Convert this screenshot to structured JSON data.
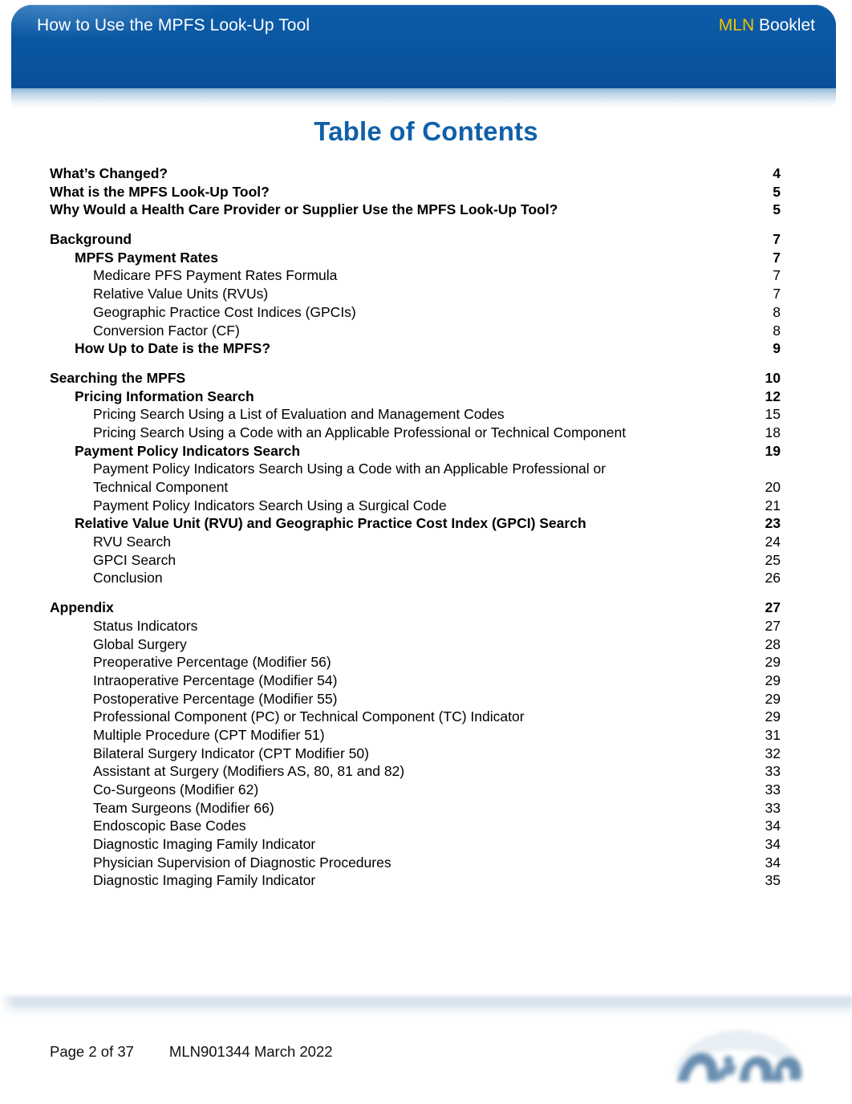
{
  "header": {
    "title": "How to Use the MPFS Look-Up Tool",
    "brand_mln": "MLN",
    "brand_rest": " Booklet",
    "bar_color": "#0a58a2",
    "brand_accent": "#f2c300"
  },
  "page_title": "Table of Contents",
  "title_color": "#1060a8",
  "toc": {
    "groups": [
      {
        "rows": [
          {
            "label": "What’s Changed?",
            "page": "4",
            "level": 0,
            "bold": true
          },
          {
            "label": "What is the MPFS Look-Up Tool?",
            "page": "5",
            "level": 0,
            "bold": true
          },
          {
            "label": "Why Would a Health Care Provider or Supplier Use the MPFS Look-Up Tool?",
            "page": "5",
            "level": 0,
            "bold": true
          }
        ]
      },
      {
        "rows": [
          {
            "label": "Background",
            "page": "7",
            "level": 0,
            "bold": true
          },
          {
            "label": "MPFS Payment Rates",
            "page": "7",
            "level": 1,
            "bold": true
          },
          {
            "label": "Medicare PFS Payment Rates Formula",
            "page": "7",
            "level": 2,
            "bold": false
          },
          {
            "label": "Relative Value Units (RVUs)",
            "page": "7",
            "level": 2,
            "bold": false
          },
          {
            "label": "Geographic Practice Cost Indices (GPCIs)",
            "page": "8",
            "level": 2,
            "bold": false
          },
          {
            "label": "Conversion Factor (CF)",
            "page": "8",
            "level": 2,
            "bold": false
          },
          {
            "label": "How Up to Date is the MPFS?",
            "page": "9",
            "level": 1,
            "bold": true
          }
        ]
      },
      {
        "rows": [
          {
            "label": "Searching the MPFS",
            "page": "10",
            "level": 0,
            "bold": true
          },
          {
            "label": "Pricing Information Search",
            "page": "12",
            "level": 1,
            "bold": true
          },
          {
            "label": "Pricing Search Using a List of Evaluation and Management Codes",
            "page": "15",
            "level": 2,
            "bold": false
          },
          {
            "label": "Pricing Search Using a Code with an Applicable Professional or Technical Component",
            "page": "18",
            "level": 2,
            "bold": false
          },
          {
            "label": "Payment Policy Indicators Search",
            "page": "19",
            "level": 1,
            "bold": true
          },
          {
            "label": "Payment Policy Indicators Search Using a Code with an Applicable Professional or",
            "page": "",
            "level": 2,
            "bold": false
          },
          {
            "label": "Technical Component",
            "page": "20",
            "level": 2,
            "bold": false,
            "continuation": true
          },
          {
            "label": "Payment Policy Indicators Search Using a Surgical Code",
            "page": "21",
            "level": 2,
            "bold": false
          },
          {
            "label": "Relative Value Unit (RVU) and Geographic Practice Cost Index (GPCI) Search",
            "page": "23",
            "level": 1,
            "bold": true
          },
          {
            "label": "RVU Search",
            "page": "24",
            "level": 2,
            "bold": false
          },
          {
            "label": "GPCI Search",
            "page": "25",
            "level": 2,
            "bold": false
          },
          {
            "label": "Conclusion",
            "page": "26",
            "level": 2,
            "bold": false
          }
        ]
      },
      {
        "rows": [
          {
            "label": "Appendix",
            "page": "27",
            "level": 0,
            "bold": true
          },
          {
            "label": "Status Indicators",
            "page": "27",
            "level": 2,
            "bold": false
          },
          {
            "label": "Global Surgery",
            "page": "28",
            "level": 2,
            "bold": false
          },
          {
            "label": "Preoperative Percentage (Modifier 56)",
            "page": "29",
            "level": 2,
            "bold": false
          },
          {
            "label": "Intraoperative Percentage (Modifier 54)",
            "page": "29",
            "level": 2,
            "bold": false
          },
          {
            "label": "Postoperative Percentage (Modifier 55)",
            "page": "29",
            "level": 2,
            "bold": false
          },
          {
            "label": "Professional Component (PC) or Technical Component (TC) Indicator",
            "page": "29",
            "level": 2,
            "bold": false
          },
          {
            "label": "Multiple Procedure (CPT Modifier 51)",
            "page": "31",
            "level": 2,
            "bold": false
          },
          {
            "label": "Bilateral Surgery Indicator (CPT Modifier 50)",
            "page": "32",
            "level": 2,
            "bold": false
          },
          {
            "label": "Assistant at Surgery (Modifiers AS, 80, 81 and 82)",
            "page": "33",
            "level": 2,
            "bold": false
          },
          {
            "label": "Co-Surgeons (Modifier 62)",
            "page": "33",
            "level": 2,
            "bold": false
          },
          {
            "label": "Team Surgeons (Modifier 66)",
            "page": "33",
            "level": 2,
            "bold": false
          },
          {
            "label": "Endoscopic Base Codes",
            "page": "34",
            "level": 2,
            "bold": false
          },
          {
            "label": "Diagnostic Imaging Family Indicator",
            "page": "34",
            "level": 2,
            "bold": false
          },
          {
            "label": "Physician Supervision of Diagnostic Procedures",
            "page": "34",
            "level": 2,
            "bold": false
          },
          {
            "label": "Diagnostic Imaging Family Indicator",
            "page": "35",
            "level": 2,
            "bold": false
          }
        ]
      }
    ]
  },
  "footer": {
    "page_label": "Page 2 of 37",
    "doc_id": "MLN901344 March 2022",
    "logo": "cms-logo"
  }
}
